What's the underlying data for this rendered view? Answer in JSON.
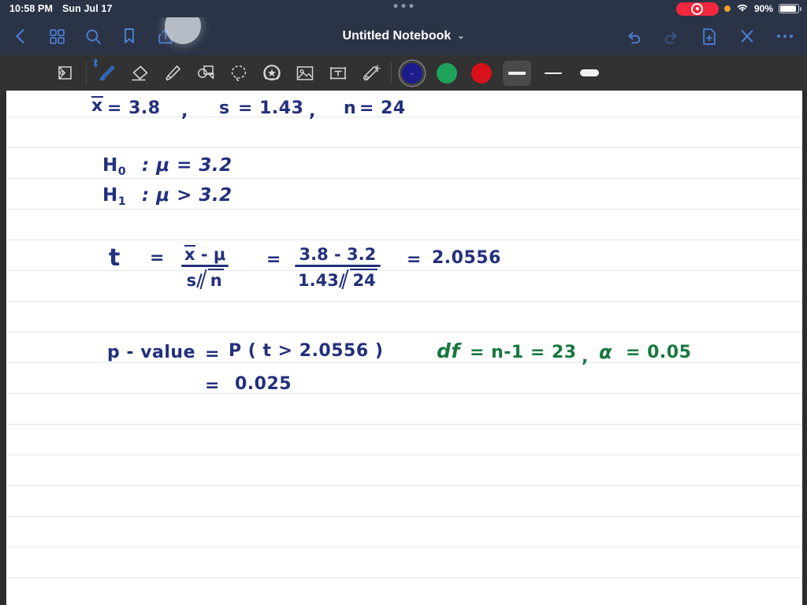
{
  "status_bar": {
    "time": "10:58 PM",
    "date": "Sun Jul 17",
    "battery_percent": "90%",
    "battery_level": 90,
    "recording_icon": "screen-recording-icon",
    "orange_dot_icon": "microphone-in-use-icon",
    "wifi_icon": "wifi-icon",
    "battery_icon": "battery-icon"
  },
  "navbar": {
    "title": "Untitled Notebook",
    "title_chevron": "⌄",
    "left_icons": [
      {
        "name": "back-chevron-icon",
        "label": "Back"
      },
      {
        "name": "grid-library-icon",
        "label": "Library"
      },
      {
        "name": "search-icon",
        "label": "Search"
      },
      {
        "name": "bookmark-icon",
        "label": "Bookmark"
      },
      {
        "name": "share-icon",
        "label": "Share"
      }
    ],
    "right_icons": [
      {
        "name": "undo-icon",
        "label": "Undo"
      },
      {
        "name": "redo-icon",
        "label": "Redo"
      },
      {
        "name": "add-page-icon",
        "label": "New Page"
      },
      {
        "name": "close-icon",
        "label": "Close"
      },
      {
        "name": "more-icon",
        "label": "More"
      }
    ]
  },
  "toolbar": {
    "tools": [
      {
        "name": "page-layers-icon",
        "label": "Page",
        "selected": false
      },
      {
        "name": "pen-icon",
        "label": "Pen",
        "selected": true,
        "badge": "bluetooth-icon"
      },
      {
        "name": "eraser-icon",
        "label": "Eraser",
        "selected": false
      },
      {
        "name": "highlighter-icon",
        "label": "Highlighter",
        "selected": false
      },
      {
        "name": "shapes-icon",
        "label": "Shapes",
        "selected": false
      },
      {
        "name": "lasso-icon",
        "label": "Lasso",
        "selected": false
      },
      {
        "name": "sticker-icon",
        "label": "Sticker",
        "selected": false
      },
      {
        "name": "image-icon",
        "label": "Image",
        "selected": false
      },
      {
        "name": "text-box-icon",
        "label": "Text Box",
        "selected": false
      },
      {
        "name": "magic-wand-icon",
        "label": "Magic",
        "selected": false
      }
    ],
    "colors": [
      {
        "name": "color-swatch-navy",
        "hex": "#1c1c8c",
        "selected": true
      },
      {
        "name": "color-swatch-green",
        "hex": "#1da35a",
        "selected": false
      },
      {
        "name": "color-swatch-red",
        "hex": "#d8111b",
        "selected": false
      }
    ],
    "widths": [
      {
        "name": "stroke-width-thick",
        "active": true
      },
      {
        "name": "stroke-width-thin",
        "active": false
      },
      {
        "name": "stroke-width-round",
        "active": false
      }
    ]
  },
  "notes": {
    "line1": {
      "xbar_symbol": "x",
      "xbar_value": "= 3.8",
      "comma1": ",",
      "s_label": "s",
      "s_value": "= 1.43",
      "comma2": ",",
      "n_label": "n",
      "n_value": "= 24"
    },
    "hypotheses": {
      "h0_label": "H",
      "h0_sub": "0",
      "h0_text": ":   μ = 3.2",
      "h1_label": "H",
      "h1_sub": "1",
      "h1_text": ":   μ > 3.2"
    },
    "tstat": {
      "t_symbol": "t",
      "eq1": "=",
      "num1": "x - μ",
      "den1": "s/",
      "den1_root": "n",
      "eq2": "=",
      "num2": "3.8 - 3.2",
      "den2": "1.43/",
      "den2_root": "24",
      "eq3": "=",
      "result": "2.0556"
    },
    "pvalue": {
      "label": "p - value",
      "eq1": "=",
      "expression": "P ( t  >  2.0556 )",
      "eq2": "=",
      "result": "0.025"
    },
    "green_note": {
      "df_label": "df",
      "df_expr": "= n-1 = 23",
      "comma": ",",
      "alpha": "α",
      "alpha_eq": "=  0.05"
    }
  },
  "colors": {
    "navbar_bg": "#2b3346",
    "toolbar_bg": "#323232",
    "accent_blue": "#4a7fd4",
    "ink_navy": "#23307c",
    "ink_green": "#19783f",
    "paper": "#ffffff",
    "rule_line": "#e3e5e8"
  }
}
